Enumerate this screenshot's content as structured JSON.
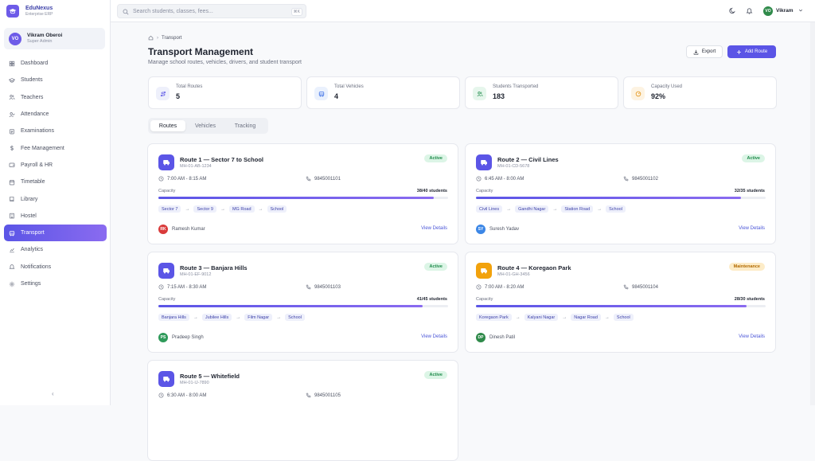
{
  "brand": {
    "name": "EduNexus",
    "subtitle": "Enterprise ERP"
  },
  "user": {
    "initials": "VO",
    "name": "Vikram Oberoi",
    "role": "Super Admin"
  },
  "nav": [
    {
      "label": "Dashboard",
      "icon": "grid-icon"
    },
    {
      "label": "Students",
      "icon": "graduation-cap-icon"
    },
    {
      "label": "Teachers",
      "icon": "users-icon"
    },
    {
      "label": "Attendance",
      "icon": "user-check-icon"
    },
    {
      "label": "Examinations",
      "icon": "clipboard-icon"
    },
    {
      "label": "Fee Management",
      "icon": "dollar-icon"
    },
    {
      "label": "Payroll & HR",
      "icon": "wallet-icon"
    },
    {
      "label": "Timetable",
      "icon": "calendar-icon"
    },
    {
      "label": "Library",
      "icon": "book-icon"
    },
    {
      "label": "Hostel",
      "icon": "building-icon"
    },
    {
      "label": "Transport",
      "icon": "bus-icon",
      "active": true
    },
    {
      "label": "Analytics",
      "icon": "chart-icon"
    },
    {
      "label": "Notifications",
      "icon": "bell-icon"
    },
    {
      "label": "Settings",
      "icon": "gear-icon"
    }
  ],
  "collapse_label": "‹",
  "search": {
    "placeholder": "Search students, classes, fees...",
    "shortcut": "⌘K"
  },
  "topbar": {
    "initials": "VO",
    "name": "Vikram"
  },
  "breadcrumb": {
    "current": "Transport"
  },
  "page": {
    "title": "Transport Management",
    "subtitle": "Manage school routes, vehicles, drivers, and student transport"
  },
  "actions": {
    "export": "Export",
    "add": "Add Route"
  },
  "stats": [
    {
      "label": "Total Routes",
      "value": "5",
      "color": "#5b55e6",
      "bg": "#eef0fb",
      "icon": "route-icon"
    },
    {
      "label": "Total Vehicles",
      "value": "4",
      "color": "#3b6fe6",
      "bg": "#eaf1fd",
      "icon": "bus-icon"
    },
    {
      "label": "Students Transported",
      "value": "183",
      "color": "#1e8a4a",
      "bg": "#e6f6ec",
      "icon": "users-icon"
    },
    {
      "label": "Capacity Used",
      "value": "92%",
      "color": "#e08a00",
      "bg": "#fdf3e2",
      "icon": "gauge-icon"
    }
  ],
  "tabs": [
    "Routes",
    "Vehicles",
    "Tracking"
  ],
  "routes": [
    {
      "title": "Route 1 — Sector 7 to School",
      "reg": "MH-01-AB-1234",
      "status": "Active",
      "time": "7:00 AM - 8:15 AM",
      "phone": "9845001101",
      "capacity_label": "Capacity",
      "capacity_text": "38/40 students",
      "fill": 0.95,
      "stops": [
        "Sector 7",
        "Sector 9",
        "MG Road",
        "School"
      ],
      "driver_initials": "RK",
      "driver": "Ramesh Kumar",
      "driver_color": "#d93a3a",
      "icon_color": "#5b55e6",
      "view": "View Details"
    },
    {
      "title": "Route 2 — Civil Lines",
      "reg": "MH-01-CD-5678",
      "status": "Active",
      "time": "6:45 AM - 8:00 AM",
      "phone": "9845001102",
      "capacity_label": "Capacity",
      "capacity_text": "32/35 students",
      "fill": 0.914,
      "stops": [
        "Civil Lines",
        "Gandhi Nagar",
        "Station Road",
        "School"
      ],
      "driver_initials": "SY",
      "driver": "Suresh Yadav",
      "driver_color": "#3b86e6",
      "icon_color": "#5b55e6",
      "view": "View Details"
    },
    {
      "title": "Route 3 — Banjara Hills",
      "reg": "MH-01-EF-9012",
      "status": "Active",
      "time": "7:15 AM - 8:30 AM",
      "phone": "9845001103",
      "capacity_label": "Capacity",
      "capacity_text": "41/45 students",
      "fill": 0.911,
      "stops": [
        "Banjara Hills",
        "Jubilee Hills",
        "Film Nagar",
        "School"
      ],
      "driver_initials": "PS",
      "driver": "Pradeep Singh",
      "driver_color": "#2f9a5a",
      "icon_color": "#5b55e6",
      "view": "View Details"
    },
    {
      "title": "Route 4 — Koregaon Park",
      "reg": "MH-01-GH-3456",
      "status": "Maintenance",
      "time": "7:00 AM - 8:20 AM",
      "phone": "9845001104",
      "capacity_label": "Capacity",
      "capacity_text": "28/30 students",
      "fill": 0.933,
      "stops": [
        "Koregaon Park",
        "Kalyani Nagar",
        "Nagar Road",
        "School"
      ],
      "driver_initials": "DP",
      "driver": "Dinesh Patil",
      "driver_color": "#2f8a4a",
      "icon_color": "#f2a20c",
      "view": "View Details"
    },
    {
      "title": "Route 5 — Whitefield",
      "reg": "MH-01-IJ-7890",
      "status": "Active",
      "time": "6:30 AM - 8:00 AM",
      "phone": "9845001105",
      "capacity_label": "",
      "capacity_text": "",
      "fill": 0,
      "stops": [],
      "driver_initials": "",
      "driver": "",
      "driver_color": "#5b55e6",
      "icon_color": "#5b55e6",
      "view": ""
    }
  ]
}
